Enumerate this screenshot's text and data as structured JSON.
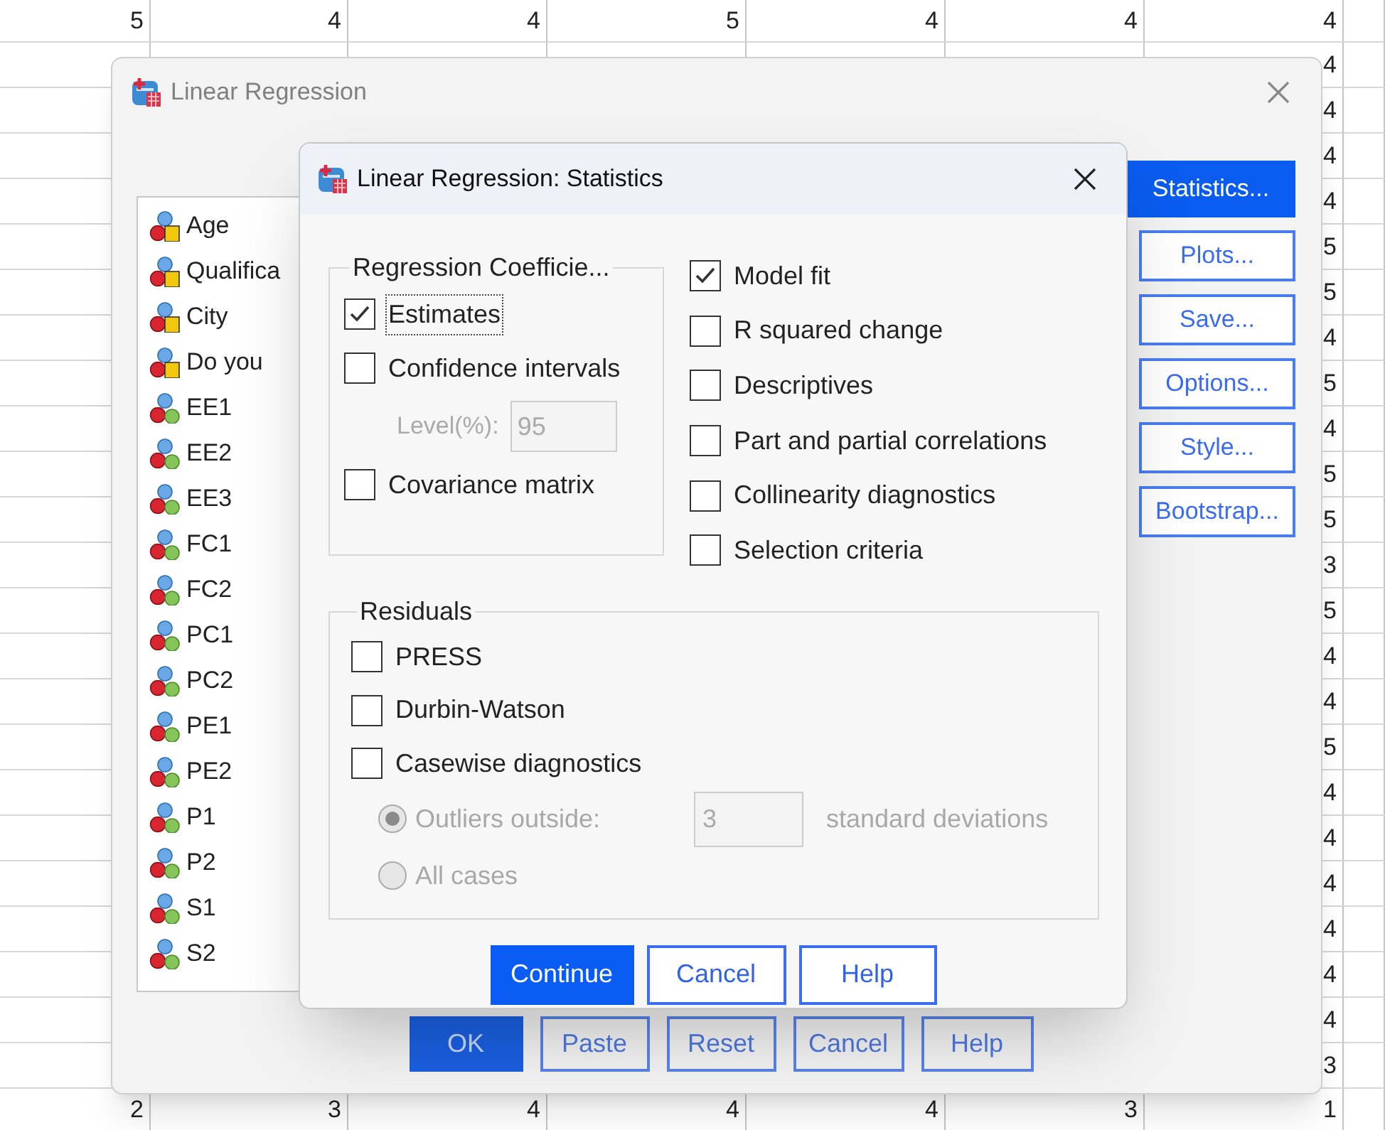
{
  "spreadsheet": {
    "top_row": [
      "5",
      "4",
      "4",
      "5",
      "4",
      "4",
      "4"
    ],
    "right_column": [
      "4",
      "4",
      "4",
      "4",
      "5",
      "5",
      "4",
      "5",
      "4",
      "5",
      "5",
      "3",
      "5",
      "4",
      "4",
      "5",
      "4",
      "4",
      "4",
      "4",
      "4",
      "4",
      "3"
    ],
    "bottom_row": [
      "2",
      "3",
      "4",
      "4",
      "4",
      "3",
      "1"
    ]
  },
  "main_dialog": {
    "title": "Linear Regression",
    "active": false,
    "variables": [
      {
        "name": "Age",
        "kind": "nominal"
      },
      {
        "name": "Qualifica",
        "kind": "nominal"
      },
      {
        "name": "City",
        "kind": "nominal"
      },
      {
        "name": "Do you",
        "kind": "nominal"
      },
      {
        "name": "EE1",
        "kind": "scale"
      },
      {
        "name": "EE2",
        "kind": "scale"
      },
      {
        "name": "EE3",
        "kind": "scale"
      },
      {
        "name": "FC1",
        "kind": "scale"
      },
      {
        "name": "FC2",
        "kind": "scale"
      },
      {
        "name": "PC1",
        "kind": "scale"
      },
      {
        "name": "PC2",
        "kind": "scale"
      },
      {
        "name": "PE1",
        "kind": "scale"
      },
      {
        "name": "PE2",
        "kind": "scale"
      },
      {
        "name": "P1",
        "kind": "scale"
      },
      {
        "name": "P2",
        "kind": "scale"
      },
      {
        "name": "S1",
        "kind": "scale"
      },
      {
        "name": "S2",
        "kind": "scale"
      }
    ],
    "side_buttons": [
      {
        "label": "Statistics...",
        "selected": true
      },
      {
        "label": "Plots...",
        "selected": false
      },
      {
        "label": "Save...",
        "selected": false
      },
      {
        "label": "Options...",
        "selected": false
      },
      {
        "label": "Style...",
        "selected": false
      },
      {
        "label": "Bootstrap...",
        "selected": false
      }
    ],
    "buttons": [
      {
        "label": "OK",
        "default": true
      },
      {
        "label": "Paste",
        "default": false
      },
      {
        "label": "Reset",
        "default": false
      },
      {
        "label": "Cancel",
        "default": false
      },
      {
        "label": "Help",
        "default": false
      }
    ]
  },
  "statistics_dialog": {
    "title": "Linear Regression: Statistics",
    "coefficients": {
      "title": "Regression Coefficie...",
      "options": [
        {
          "kind": "checkbox",
          "label": "Estimates",
          "checked": true,
          "focused": true
        },
        {
          "kind": "checkbox",
          "label": "Confidence intervals",
          "checked": false,
          "focused": false
        },
        {
          "kind": "field",
          "label": "Level(%):",
          "value": "95",
          "disabled": true
        },
        {
          "kind": "checkbox",
          "label": "Covariance matrix",
          "checked": false,
          "focused": false
        }
      ]
    },
    "model_options": [
      {
        "kind": "checkbox",
        "label": "Model fit",
        "checked": true,
        "focused": false
      },
      {
        "kind": "checkbox",
        "label": "R squared change",
        "checked": false,
        "focused": false
      },
      {
        "kind": "checkbox",
        "label": "Descriptives",
        "checked": false,
        "focused": false
      },
      {
        "kind": "checkbox",
        "label": "Part and partial correlations",
        "checked": false,
        "focused": false
      },
      {
        "kind": "checkbox",
        "label": "Collinearity diagnostics",
        "checked": false,
        "focused": false
      },
      {
        "kind": "checkbox",
        "label": "Selection criteria",
        "checked": false,
        "focused": false
      }
    ],
    "residuals": {
      "title": "Residuals",
      "options": [
        {
          "kind": "checkbox",
          "label": "PRESS",
          "checked": false,
          "focused": false
        },
        {
          "kind": "checkbox",
          "label": "Durbin-Watson",
          "checked": false,
          "focused": false
        },
        {
          "kind": "checkbox",
          "label": "Casewise diagnostics",
          "checked": false,
          "focused": false
        },
        {
          "kind": "radio",
          "label": "Outliers outside:",
          "selected": true,
          "disabled": true,
          "value": "3",
          "suffix": "standard deviations"
        },
        {
          "kind": "radio",
          "label": "All cases",
          "selected": false,
          "disabled": true
        }
      ]
    },
    "buttons": [
      {
        "label": "Continue",
        "default": true
      },
      {
        "label": "Cancel",
        "default": false
      },
      {
        "label": "Help",
        "default": false
      }
    ]
  }
}
